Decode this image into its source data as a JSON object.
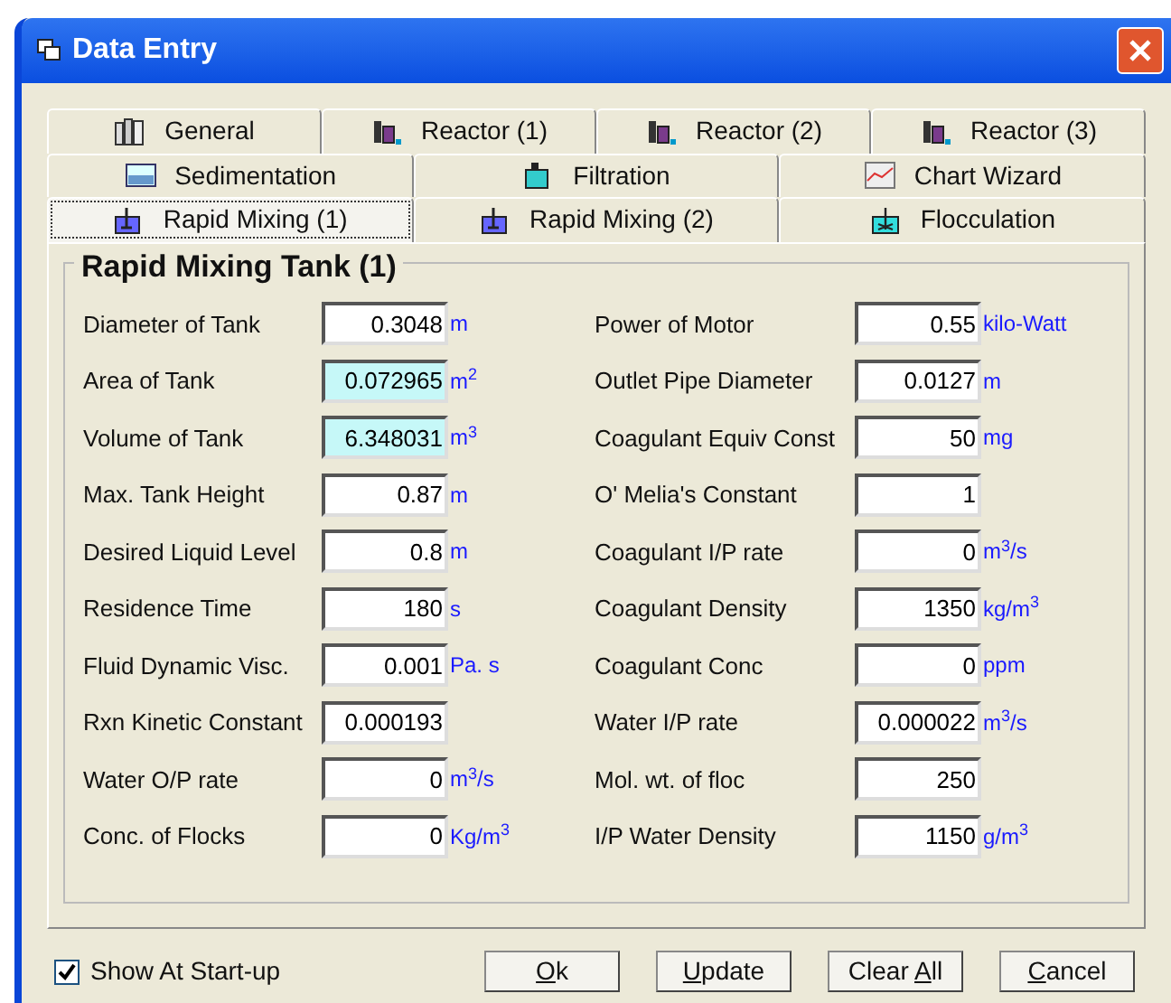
{
  "window": {
    "title": "Data Entry"
  },
  "tab_rows": [
    [
      {
        "label": "General",
        "kind": "books",
        "selected": false
      },
      {
        "label": "Reactor (1)",
        "kind": "reactor",
        "selected": false
      },
      {
        "label": "Reactor (2)",
        "kind": "reactor",
        "selected": false
      },
      {
        "label": "Reactor (3)",
        "kind": "reactor",
        "selected": false
      }
    ],
    [
      {
        "label": "Sedimentation",
        "kind": "basin",
        "selected": false
      },
      {
        "label": "Filtration",
        "kind": "filter",
        "selected": false
      },
      {
        "label": "Chart Wizard",
        "kind": "chart",
        "selected": false
      }
    ],
    [
      {
        "label": "Rapid Mixing (1)",
        "kind": "mixer",
        "selected": true
      },
      {
        "label": "Rapid Mixing (2)",
        "kind": "mixer",
        "selected": false
      },
      {
        "label": "Flocculation",
        "kind": "floc",
        "selected": false
      }
    ]
  ],
  "group": {
    "title": "Rapid Mixing Tank (1)",
    "left_fields": [
      {
        "label": "Diameter of Tank",
        "value": "0.3048",
        "unit": "m",
        "highlighted": false
      },
      {
        "label": "Area of Tank",
        "value": "0.072965",
        "unit": "m$^{2}$",
        "highlighted": true
      },
      {
        "label": "Volume of Tank",
        "value": "6.348031",
        "unit": "m$^{3}$",
        "highlighted": true
      },
      {
        "label": "Max. Tank Height",
        "value": "0.87",
        "unit": "m",
        "highlighted": false
      },
      {
        "label": "Desired Liquid Level",
        "value": "0.8",
        "unit": "m",
        "highlighted": false
      },
      {
        "label": "Residence Time",
        "value": "180",
        "unit": "s",
        "highlighted": false
      },
      {
        "label": "Fluid Dynamic Visc.",
        "value": "0.001",
        "unit": "Pa. s",
        "highlighted": false
      },
      {
        "label": "Rxn Kinetic Constant",
        "value": "0.000193",
        "highlighted": false
      },
      {
        "label": "Water O/P rate",
        "value": "0",
        "unit": "m$^{3}$/s",
        "highlighted": false
      },
      {
        "label": "Conc. of Flocks",
        "value": "0",
        "unit": "Kg/m$^{3}$",
        "highlighted": false
      }
    ],
    "right_fields": [
      {
        "label": "Power of Motor",
        "value": "0.55",
        "unit": "kilo-Watt",
        "highlighted": false
      },
      {
        "label": "Outlet Pipe Diameter",
        "value": "0.0127",
        "unit": "m",
        "highlighted": false
      },
      {
        "label": "Coagulant Equiv Const",
        "value": "50",
        "unit": "mg",
        "highlighted": false
      },
      {
        "label": "O' Melia's Constant",
        "value": "1",
        "highlighted": false
      },
      {
        "label": "Coagulant I/P rate",
        "value": "0",
        "unit": "m$^{3}$/s",
        "highlighted": false
      },
      {
        "label": "Coagulant Density",
        "value": "1350",
        "unit": "kg/m$^{3}$",
        "highlighted": false
      },
      {
        "label": "Coagulant Conc",
        "value": "0",
        "unit": "ppm",
        "highlighted": false
      },
      {
        "label": "Water I/P rate",
        "value": "0.000022",
        "unit": "m$^{3}$/s",
        "highlighted": false
      },
      {
        "label": "Mol. wt. of floc",
        "value": "250",
        "highlighted": false
      },
      {
        "label": "I/P Water Density",
        "value": "1150",
        "unit": "g/m$^{3}$",
        "highlighted": false
      }
    ]
  },
  "show_at_startup": {
    "label": "Show At Start-up",
    "checked": true
  },
  "buttons": [
    {
      "mnemonic": "O",
      "after": "k"
    },
    {
      "mnemonic": "U",
      "after": "pdate"
    },
    {
      "before": "Clear ",
      "mnemonic": "A",
      "after": "ll"
    },
    {
      "mnemonic": "C",
      "after": "ancel"
    }
  ]
}
